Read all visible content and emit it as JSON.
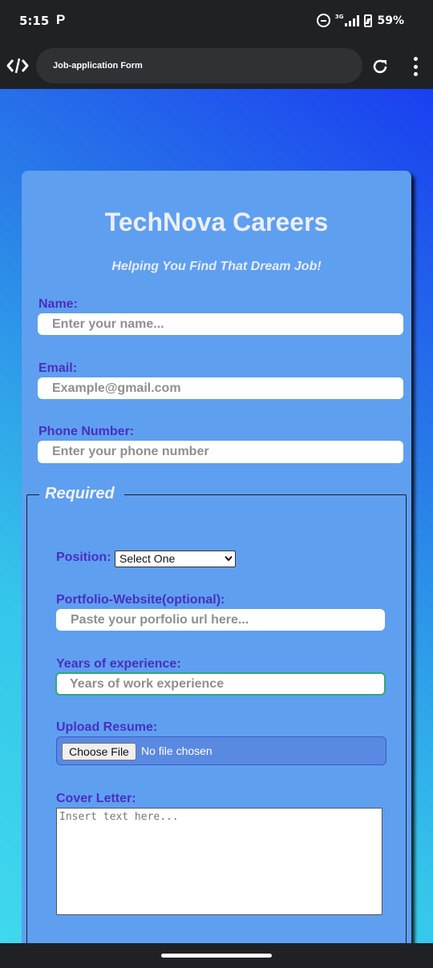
{
  "status_bar": {
    "time": "5:15",
    "app_icon": "P",
    "network": "3G",
    "battery": "59%"
  },
  "browser": {
    "tab_title": "Job-application Form"
  },
  "form": {
    "title": "TechNova Careers",
    "subtitle": "Helping You Find That Dream Job!",
    "name": {
      "label": "Name:",
      "placeholder": "Enter your name..."
    },
    "email": {
      "label": "Email:",
      "placeholder": "Example@gmail.com"
    },
    "phone": {
      "label": "Phone Number:",
      "placeholder": "Enter your phone number"
    },
    "required_section": {
      "legend": "Required",
      "position": {
        "label": "Position:",
        "selected": "Select One"
      },
      "portfolio": {
        "label": "Portfolio-Website(optional):",
        "placeholder": "Paste your porfolio url here..."
      },
      "experience": {
        "label": "Years of experience:",
        "placeholder": "Years of work experience"
      },
      "resume": {
        "label": "Upload Resume:",
        "button": "Choose File",
        "status": "No file chosen"
      },
      "cover_letter": {
        "label": "Cover Letter:",
        "placeholder": "Insert text here..."
      }
    }
  },
  "colors": {
    "card": "#5f9ff0",
    "label": "#4a2fbf",
    "focus_border": "#2fa87a"
  }
}
